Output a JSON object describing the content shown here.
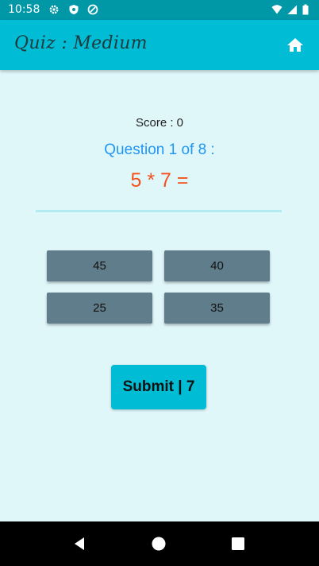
{
  "status_bar": {
    "time": "10:58",
    "icons": [
      "settings-icon",
      "shield-icon",
      "at-sign-icon",
      "wifi-icon",
      "signal-icon",
      "battery-icon"
    ]
  },
  "app_bar": {
    "title": "Quiz : Medium",
    "home_icon": "home-icon",
    "color": "#00bcd4"
  },
  "quiz": {
    "score": "Score : 0",
    "question": "Question 1 of 8 :",
    "equation": "5 * 7 =",
    "answer_value": "",
    "options": [
      "45",
      "40",
      "25",
      "35"
    ],
    "submit": "Submit | 7"
  },
  "nav_bar": {
    "icons": [
      "back-icon",
      "home-circle-icon",
      "recents-icon"
    ]
  },
  "colors": {
    "background": "#e0f7fa",
    "status_bar": "#0097a7",
    "question": "#2196f3",
    "equation": "#f4511e",
    "option_button": "#607d8b"
  }
}
